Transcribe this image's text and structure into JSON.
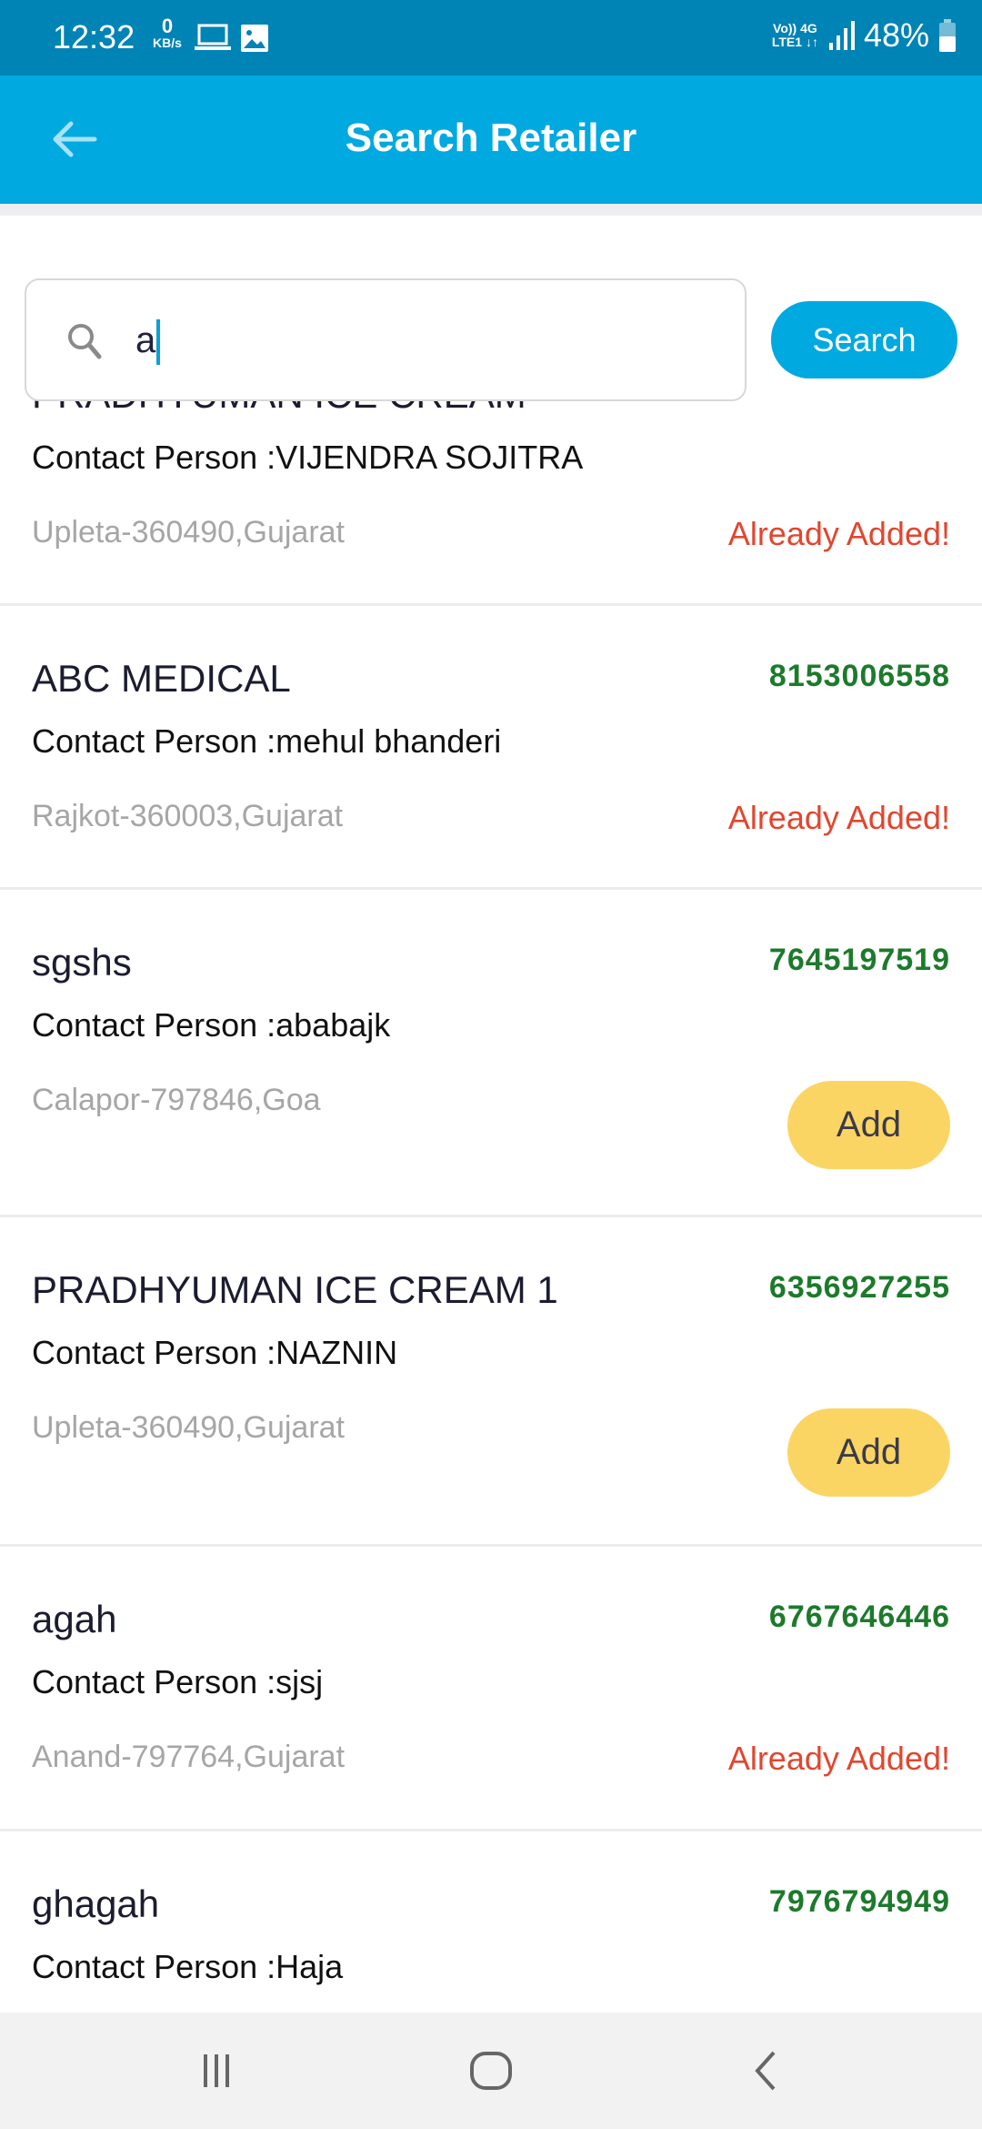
{
  "status_bar": {
    "time": "12:32",
    "speed_value": "0",
    "speed_unit": "KB/s",
    "net_top": "Vo)) 4G",
    "net_bottom": "LTE1 ↓↑",
    "battery": "48%"
  },
  "header": {
    "title": "Search Retailer"
  },
  "search": {
    "value": "a",
    "button_label": "Search"
  },
  "colors": {
    "accent": "#00a9e0",
    "status_bar": "#0083b5",
    "phone": "#1d7a2c",
    "already_added": "#e2462f",
    "add_button": "#fbd563"
  },
  "retailers": [
    {
      "name": "PRADHYUMAN ICE CREAM",
      "phone": "",
      "contact": "Contact Person :VIJENDRA SOJITRA",
      "address": "Upleta-360490,Gujarat",
      "status": "Already Added!"
    },
    {
      "name": "ABC MEDICAL",
      "phone": "8153006558",
      "contact": "Contact Person :mehul bhanderi",
      "address": "Rajkot-360003,Gujarat",
      "status": "Already Added!"
    },
    {
      "name": "sgshs",
      "phone": "7645197519",
      "contact": "Contact Person :ababajk",
      "address": "Calapor-797846,Goa",
      "action": "Add"
    },
    {
      "name": "PRADHYUMAN ICE CREAM 1",
      "phone": "6356927255",
      "contact": "Contact Person :NAZNIN",
      "address": "Upleta-360490,Gujarat",
      "action": "Add"
    },
    {
      "name": "agah",
      "phone": "6767646446",
      "contact": "Contact Person :sjsj",
      "address": "Anand-797764,Gujarat",
      "status": "Already Added!"
    },
    {
      "name": "ghagah",
      "phone": "7976794949",
      "contact": "Contact Person :Haja",
      "address": "",
      "status": ""
    }
  ]
}
